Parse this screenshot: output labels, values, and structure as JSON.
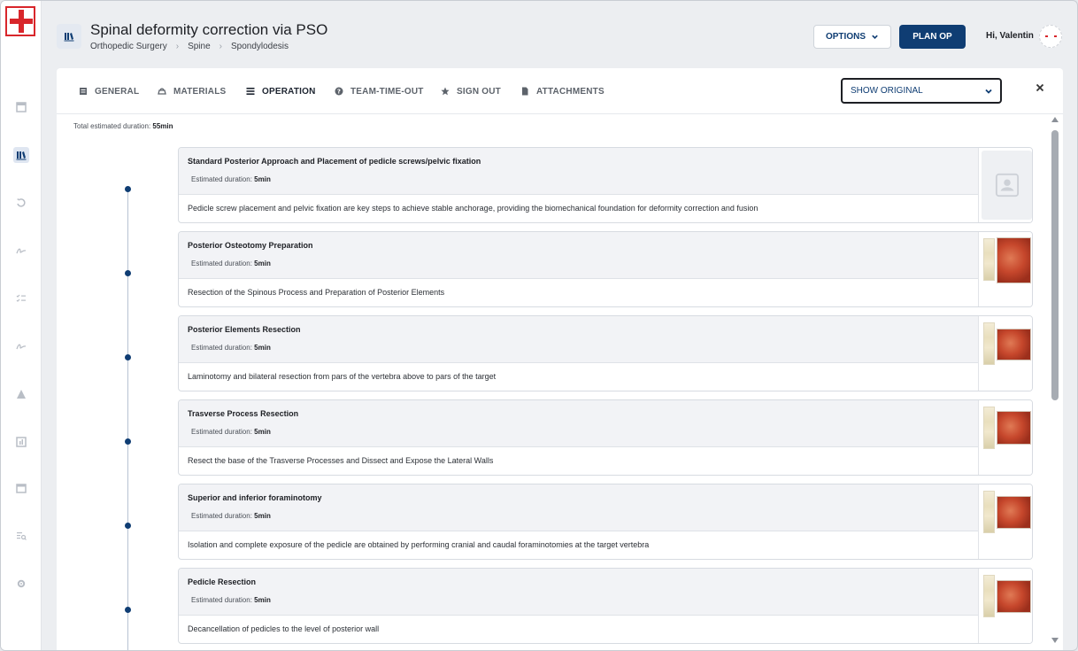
{
  "header": {
    "title": "Spinal deformity correction via PSO",
    "breadcrumb": [
      "Orthopedic Surgery",
      "Spine",
      "Spondylodesis"
    ],
    "options_label": "OPTIONS",
    "plan_label": "PLAN OP",
    "greeting": "Hi, Valentin"
  },
  "tabs": [
    {
      "label": "GENERAL",
      "icon": "general-icon"
    },
    {
      "label": "MATERIALS",
      "icon": "materials-icon"
    },
    {
      "label": "OPERATION",
      "icon": "list-icon",
      "active": true
    },
    {
      "label": "TEAM-TIME-OUT",
      "icon": "help-circle-icon"
    },
    {
      "label": "SIGN OUT",
      "icon": "star-icon"
    },
    {
      "label": "ATTACHMENTS",
      "icon": "file-icon"
    }
  ],
  "view_select": {
    "value": "SHOW ORIGINAL"
  },
  "total": {
    "label": "Total estimated duration:",
    "value": "55min"
  },
  "steps": [
    {
      "title": "Standard Posterior Approach and Placement of pedicle screws/pelvic fixation",
      "duration_label": "Estimated duration:",
      "duration": "5min",
      "description": "Pedicle screw placement and pelvic fixation are key steps to achieve stable anchorage, providing the biomechanical foundation for deformity correction and fusion"
    },
    {
      "title": "Posterior Osteotomy Preparation",
      "duration_label": "Estimated duration:",
      "duration": "5min",
      "description": "Resection of the Spinous Process and Preparation of Posterior Elements"
    },
    {
      "title": "Posterior Elements Resection",
      "duration_label": "Estimated duration:",
      "duration": "5min",
      "description": "Laminotomy and bilateral resection from pars of the vertebra above to pars of the target"
    },
    {
      "title": "Trasverse Process Resection",
      "duration_label": "Estimated duration:",
      "duration": "5min",
      "description": "Resect the base of the Trasverse Processes and Dissect and Expose the Lateral Walls"
    },
    {
      "title": "Superior and inferior foraminotomy",
      "duration_label": "Estimated duration:",
      "duration": "5min",
      "description": "Isolation and complete exposure of the pedicle are obtained by performing cranial and caudal foraminotomies at the target vertebra"
    },
    {
      "title": "Pedicle Resection",
      "duration_label": "Estimated duration:",
      "duration": "5min",
      "description": "Decancellation of pedicles to the level of posterior wall"
    }
  ],
  "colors": {
    "primary": "#0f3d73",
    "brand_red": "#d8262b",
    "card_header": "#f2f3f6"
  }
}
